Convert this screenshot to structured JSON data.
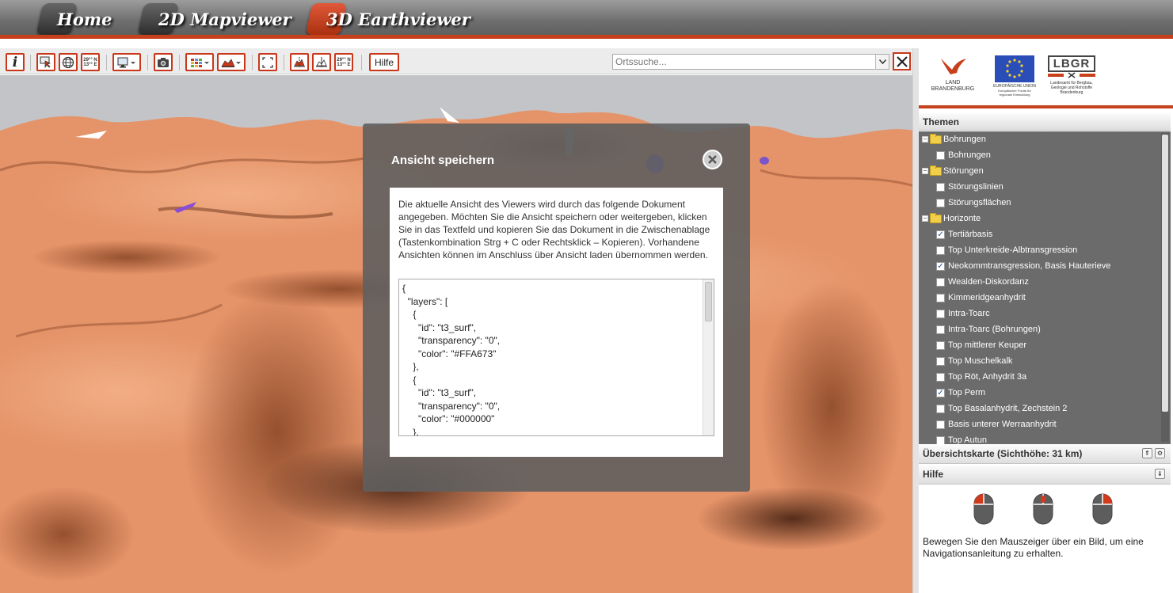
{
  "nav": {
    "tabs": [
      {
        "label": "Home",
        "active": false
      },
      {
        "label": "2D Mapviewer",
        "active": false
      },
      {
        "label": "3D Earthviewer",
        "active": true
      }
    ]
  },
  "toolbar": {
    "icons": [
      "info-icon",
      "select-icon",
      "globe-icon",
      "coordinates-icon",
      "monitor-icon",
      "camera-icon",
      "grid-icon",
      "profile-icon",
      "fullextent-icon",
      "cut-plane-icon",
      "cross-section-icon",
      "coordinates-icon"
    ],
    "coord_label_1": "29°° N",
    "coord_label_2": "13°° E",
    "hilfe_label": "Hilfe",
    "search_placeholder": "Ortssuche..."
  },
  "logos": {
    "brandenburg_line1": "LAND",
    "brandenburg_line2": "BRANDENBURG",
    "eu_line1": "EUROPÄISCHE UNION",
    "eu_line2": "Europäischer Fonds für regionale Entwicklung",
    "lbgr_title": "LBGR",
    "lbgr_line1": "Landesamt für Bergbau,",
    "lbgr_line2": "Geologie und Rohstoffe",
    "lbgr_line3": "Brandenburg"
  },
  "themes": {
    "title": "Themen",
    "items": [
      {
        "label": "Bohrungen",
        "type": "group"
      },
      {
        "label": "Bohrungen",
        "type": "layer",
        "checked": false
      },
      {
        "label": "Störungen",
        "type": "group"
      },
      {
        "label": "Störungslinien",
        "type": "layer",
        "checked": false
      },
      {
        "label": "Störungsflächen",
        "type": "layer",
        "checked": false
      },
      {
        "label": "Horizonte",
        "type": "group"
      },
      {
        "label": "Tertiärbasis",
        "type": "layer",
        "checked": true
      },
      {
        "label": "Top Unterkreide-Albtransgression",
        "type": "layer",
        "checked": false
      },
      {
        "label": "Neokommtransgression, Basis Hauterieve",
        "type": "layer",
        "checked": true
      },
      {
        "label": "Wealden-Diskordanz",
        "type": "layer",
        "checked": false
      },
      {
        "label": "Kimmeridgeanhydrit",
        "type": "layer",
        "checked": false
      },
      {
        "label": "Intra-Toarc",
        "type": "layer",
        "checked": false
      },
      {
        "label": "Intra-Toarc (Bohrungen)",
        "type": "layer",
        "checked": false
      },
      {
        "label": "Top mittlerer Keuper",
        "type": "layer",
        "checked": false
      },
      {
        "label": "Top Muschelkalk",
        "type": "layer",
        "checked": false
      },
      {
        "label": "Top Röt, Anhydrit 3a",
        "type": "layer",
        "checked": false
      },
      {
        "label": "Top Perm",
        "type": "layer",
        "checked": true
      },
      {
        "label": "Top Basalanhydrit, Zechstein 2",
        "type": "layer",
        "checked": false
      },
      {
        "label": "Basis unterer Werraanhydrit",
        "type": "layer",
        "checked": false
      },
      {
        "label": "Top Autun",
        "type": "layer",
        "checked": false
      }
    ]
  },
  "overview": {
    "title": "Übersichtskarte (Sichthöhe: 31 km)"
  },
  "help": {
    "title": "Hilfe",
    "text": "Bewegen Sie den Mauszeiger über ein Bild, um eine Navigationsanleitung zu erhalten."
  },
  "dialog": {
    "title": "Ansicht speichern",
    "description": "Die aktuelle Ansicht des Viewers wird durch das folgende Dokument angegeben. Möchten Sie die Ansicht speichern oder weitergeben, klicken Sie in das Textfeld und kopieren Sie das Dokument in die Zwischenablage (Tastenkombination Strg + C oder Rechtsklick – Kopieren). Vorhandene Ansichten können im Anschluss über Ansicht laden übernommen werden.",
    "json_text": "{\n  \"layers\": [\n    {\n      \"id\": \"t3_surf\",\n      \"transparency\": \"0\",\n      \"color\": \"#FFA673\"\n    },\n    {\n      \"id\": \"t3_surf\",\n      \"transparency\": \"0\",\n      \"color\": \"#000000\"\n    },\n    {"
  },
  "colors": {
    "accent": "#c6411b",
    "terrain": "#e59368",
    "panel": "#6b6b6b"
  }
}
